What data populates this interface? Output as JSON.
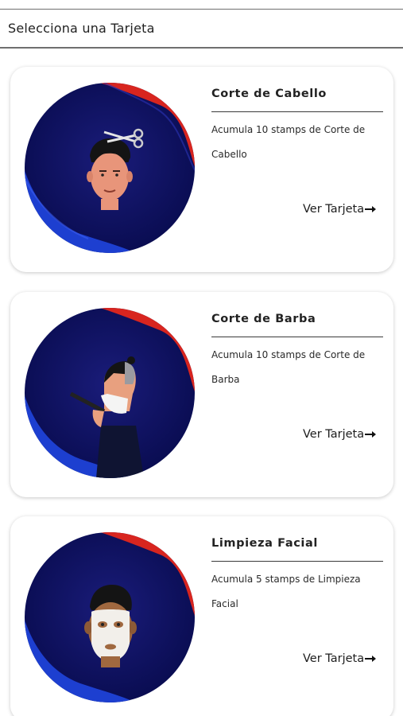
{
  "header": {
    "title": "Selecciona una Tarjeta"
  },
  "cards": [
    {
      "title": "Corte de Cabello",
      "description": "Acumula 10 stamps de Corte de Cabello",
      "link": "Ver Tarjeta",
      "icon": "haircut-icon"
    },
    {
      "title": "Corte de Barba",
      "description": "Acumula 10 stamps de Corte de Barba",
      "link": "Ver Tarjeta",
      "icon": "beard-shave-icon"
    },
    {
      "title": "Limpieza Facial",
      "description": "Acumula 5 stamps de Limpieza Facial",
      "link": "Ver Tarjeta",
      "icon": "facial-mask-icon"
    }
  ],
  "colors": {
    "circle_bg": "#0b0f5c",
    "wave_blue": "#1d3fd0",
    "wave_red": "#d8251f",
    "text": "#1d1d1d",
    "divider": "#3a3a3a"
  }
}
